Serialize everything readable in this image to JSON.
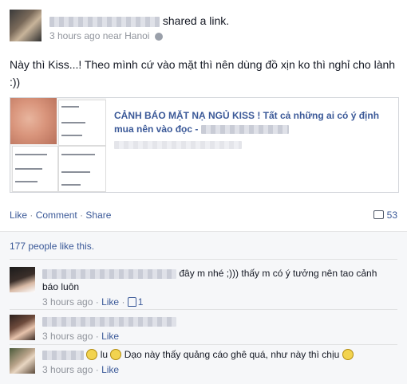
{
  "post": {
    "action_text": "shared a link.",
    "time": "3 hours ago",
    "location_prefix": "near",
    "location": "Hanoi",
    "text": "Này thì Kiss...! Theo mình cứ vào mặt thì nên dùng đồ xịn ko thì nghỉ cho lành :))"
  },
  "link_card": {
    "title": "CẢNH BÁO MẶT NẠ NGỦ KISS ! Tất cả những ai có ý định mua nên vào đọc - "
  },
  "actions": {
    "like": "Like",
    "comment": "Comment",
    "share": "Share",
    "sep": "·",
    "comment_count": "53"
  },
  "likes": {
    "text": "177 people like this."
  },
  "comments": [
    {
      "text_after_name": "đây m nhé ;))) thấy m có ý tưởng nên tao cảnh báo luôn",
      "time": "3 hours ago",
      "like": "Like",
      "like_count": "1"
    },
    {
      "time": "3 hours ago",
      "like": "Like"
    },
    {
      "text_mid": "lu",
      "text_after": "Dạo này thấy quảng cáo ghê quá, như này thì chịu",
      "time": "3 hours ago",
      "like": "Like"
    }
  ],
  "colors": {
    "link": "#3b5998",
    "muted": "#90949c",
    "text": "#141823"
  }
}
